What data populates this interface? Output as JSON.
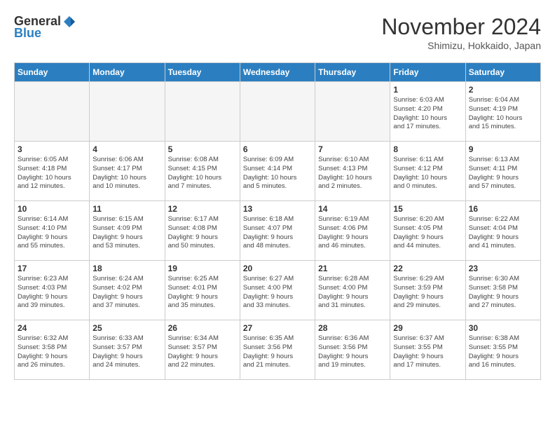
{
  "header": {
    "logo_general": "General",
    "logo_blue": "Blue",
    "month": "November 2024",
    "location": "Shimizu, Hokkaido, Japan"
  },
  "days_of_week": [
    "Sunday",
    "Monday",
    "Tuesday",
    "Wednesday",
    "Thursday",
    "Friday",
    "Saturday"
  ],
  "weeks": [
    [
      {
        "day": "",
        "info": ""
      },
      {
        "day": "",
        "info": ""
      },
      {
        "day": "",
        "info": ""
      },
      {
        "day": "",
        "info": ""
      },
      {
        "day": "",
        "info": ""
      },
      {
        "day": "1",
        "info": "Sunrise: 6:03 AM\nSunset: 4:20 PM\nDaylight: 10 hours\nand 17 minutes."
      },
      {
        "day": "2",
        "info": "Sunrise: 6:04 AM\nSunset: 4:19 PM\nDaylight: 10 hours\nand 15 minutes."
      }
    ],
    [
      {
        "day": "3",
        "info": "Sunrise: 6:05 AM\nSunset: 4:18 PM\nDaylight: 10 hours\nand 12 minutes."
      },
      {
        "day": "4",
        "info": "Sunrise: 6:06 AM\nSunset: 4:17 PM\nDaylight: 10 hours\nand 10 minutes."
      },
      {
        "day": "5",
        "info": "Sunrise: 6:08 AM\nSunset: 4:15 PM\nDaylight: 10 hours\nand 7 minutes."
      },
      {
        "day": "6",
        "info": "Sunrise: 6:09 AM\nSunset: 4:14 PM\nDaylight: 10 hours\nand 5 minutes."
      },
      {
        "day": "7",
        "info": "Sunrise: 6:10 AM\nSunset: 4:13 PM\nDaylight: 10 hours\nand 2 minutes."
      },
      {
        "day": "8",
        "info": "Sunrise: 6:11 AM\nSunset: 4:12 PM\nDaylight: 10 hours\nand 0 minutes."
      },
      {
        "day": "9",
        "info": "Sunrise: 6:13 AM\nSunset: 4:11 PM\nDaylight: 9 hours\nand 57 minutes."
      }
    ],
    [
      {
        "day": "10",
        "info": "Sunrise: 6:14 AM\nSunset: 4:10 PM\nDaylight: 9 hours\nand 55 minutes."
      },
      {
        "day": "11",
        "info": "Sunrise: 6:15 AM\nSunset: 4:09 PM\nDaylight: 9 hours\nand 53 minutes."
      },
      {
        "day": "12",
        "info": "Sunrise: 6:17 AM\nSunset: 4:08 PM\nDaylight: 9 hours\nand 50 minutes."
      },
      {
        "day": "13",
        "info": "Sunrise: 6:18 AM\nSunset: 4:07 PM\nDaylight: 9 hours\nand 48 minutes."
      },
      {
        "day": "14",
        "info": "Sunrise: 6:19 AM\nSunset: 4:06 PM\nDaylight: 9 hours\nand 46 minutes."
      },
      {
        "day": "15",
        "info": "Sunrise: 6:20 AM\nSunset: 4:05 PM\nDaylight: 9 hours\nand 44 minutes."
      },
      {
        "day": "16",
        "info": "Sunrise: 6:22 AM\nSunset: 4:04 PM\nDaylight: 9 hours\nand 41 minutes."
      }
    ],
    [
      {
        "day": "17",
        "info": "Sunrise: 6:23 AM\nSunset: 4:03 PM\nDaylight: 9 hours\nand 39 minutes."
      },
      {
        "day": "18",
        "info": "Sunrise: 6:24 AM\nSunset: 4:02 PM\nDaylight: 9 hours\nand 37 minutes."
      },
      {
        "day": "19",
        "info": "Sunrise: 6:25 AM\nSunset: 4:01 PM\nDaylight: 9 hours\nand 35 minutes."
      },
      {
        "day": "20",
        "info": "Sunrise: 6:27 AM\nSunset: 4:00 PM\nDaylight: 9 hours\nand 33 minutes."
      },
      {
        "day": "21",
        "info": "Sunrise: 6:28 AM\nSunset: 4:00 PM\nDaylight: 9 hours\nand 31 minutes."
      },
      {
        "day": "22",
        "info": "Sunrise: 6:29 AM\nSunset: 3:59 PM\nDaylight: 9 hours\nand 29 minutes."
      },
      {
        "day": "23",
        "info": "Sunrise: 6:30 AM\nSunset: 3:58 PM\nDaylight: 9 hours\nand 27 minutes."
      }
    ],
    [
      {
        "day": "24",
        "info": "Sunrise: 6:32 AM\nSunset: 3:58 PM\nDaylight: 9 hours\nand 26 minutes."
      },
      {
        "day": "25",
        "info": "Sunrise: 6:33 AM\nSunset: 3:57 PM\nDaylight: 9 hours\nand 24 minutes."
      },
      {
        "day": "26",
        "info": "Sunrise: 6:34 AM\nSunset: 3:57 PM\nDaylight: 9 hours\nand 22 minutes."
      },
      {
        "day": "27",
        "info": "Sunrise: 6:35 AM\nSunset: 3:56 PM\nDaylight: 9 hours\nand 21 minutes."
      },
      {
        "day": "28",
        "info": "Sunrise: 6:36 AM\nSunset: 3:56 PM\nDaylight: 9 hours\nand 19 minutes."
      },
      {
        "day": "29",
        "info": "Sunrise: 6:37 AM\nSunset: 3:55 PM\nDaylight: 9 hours\nand 17 minutes."
      },
      {
        "day": "30",
        "info": "Sunrise: 6:38 AM\nSunset: 3:55 PM\nDaylight: 9 hours\nand 16 minutes."
      }
    ]
  ]
}
